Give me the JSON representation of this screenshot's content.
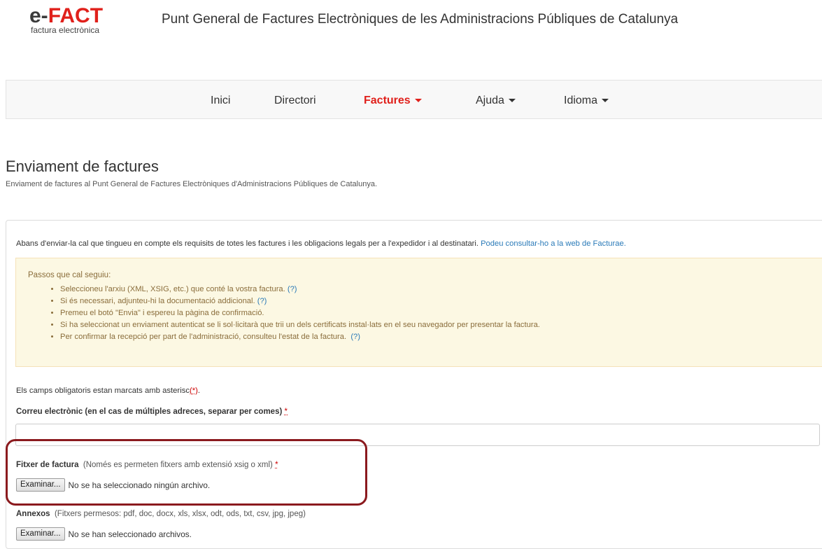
{
  "header": {
    "logo_e": "e-",
    "logo_fact": "FACT",
    "logo_subtitle": "factura electrònica",
    "site_title": "Punt General de Factures Electròniques de les Administracions Públiques de Catalunya"
  },
  "nav": {
    "items": [
      {
        "label": "Inici",
        "dropdown": false,
        "active": false
      },
      {
        "label": "Directori",
        "dropdown": false,
        "active": false
      },
      {
        "label": "Factures",
        "dropdown": true,
        "active": true
      },
      {
        "label": "Ajuda",
        "dropdown": true,
        "active": false
      },
      {
        "label": "Idioma",
        "dropdown": true,
        "active": false
      }
    ]
  },
  "page": {
    "title": "Enviament de factures",
    "subtitle": "Enviament de factures al Punt General de Factures Electròniques d'Administracions Públiques de Catalunya."
  },
  "intro": {
    "text": "Abans d'enviar-la cal que tingueu en compte els requisits de totes les factures i les obligacions legals per a l'expedidor i al destinatari.",
    "link": "Podeu consultar-ho a la web de Facturae."
  },
  "steps": {
    "title": "Passos que cal seguiu:",
    "items": [
      {
        "text": "Seleccioneu l'arxiu (XML, XSIG, etc.) que conté la vostra factura.",
        "help": "(?)"
      },
      {
        "text": "Si és necessari, adjunteu-hi la documentació addicional.",
        "help": "(?)"
      },
      {
        "text": "Premeu el botó \"Envia\" i espereu la pàgina de confirmació.",
        "help": ""
      },
      {
        "text": "Si ha seleccionat un enviament autenticat se li sol·licitarà que trii un dels certificats instal·lats en el seu navegador per presentar la factura.",
        "help": ""
      },
      {
        "text": "Per confirmar la recepció per part de l'administració, consulteu l'estat de la factura.",
        "help": "(?)"
      }
    ]
  },
  "form": {
    "required_note": "Els camps obligatoris estan marcats amb asterisc",
    "required_note_ast": "(*)",
    "required_note_end": ".",
    "asterisk": "*",
    "email_label": "Correu electrònic (en el cas de múltiples adreces, separar per comes)",
    "email_value": "",
    "invoice_file_label": "Fitxer de factura",
    "invoice_file_hint": "(Només es permeten fitxers amb extensió xsig o xml)",
    "browse_label": "Examinar...",
    "invoice_file_status": "No se ha seleccionado ningún archivo.",
    "annex_label": "Annexos",
    "annex_hint": "(Fitxers permesos: pdf, doc, docx, xls, xlsx, odt, ods, txt, csv, jpg, jpeg)",
    "annex_status": "No se han seleccionado archivos."
  },
  "colors": {
    "brand_red": "#e0201b",
    "highlight_border": "#8b1a1e",
    "link": "#2a7ab8",
    "warning_bg": "#fcf8e3"
  }
}
